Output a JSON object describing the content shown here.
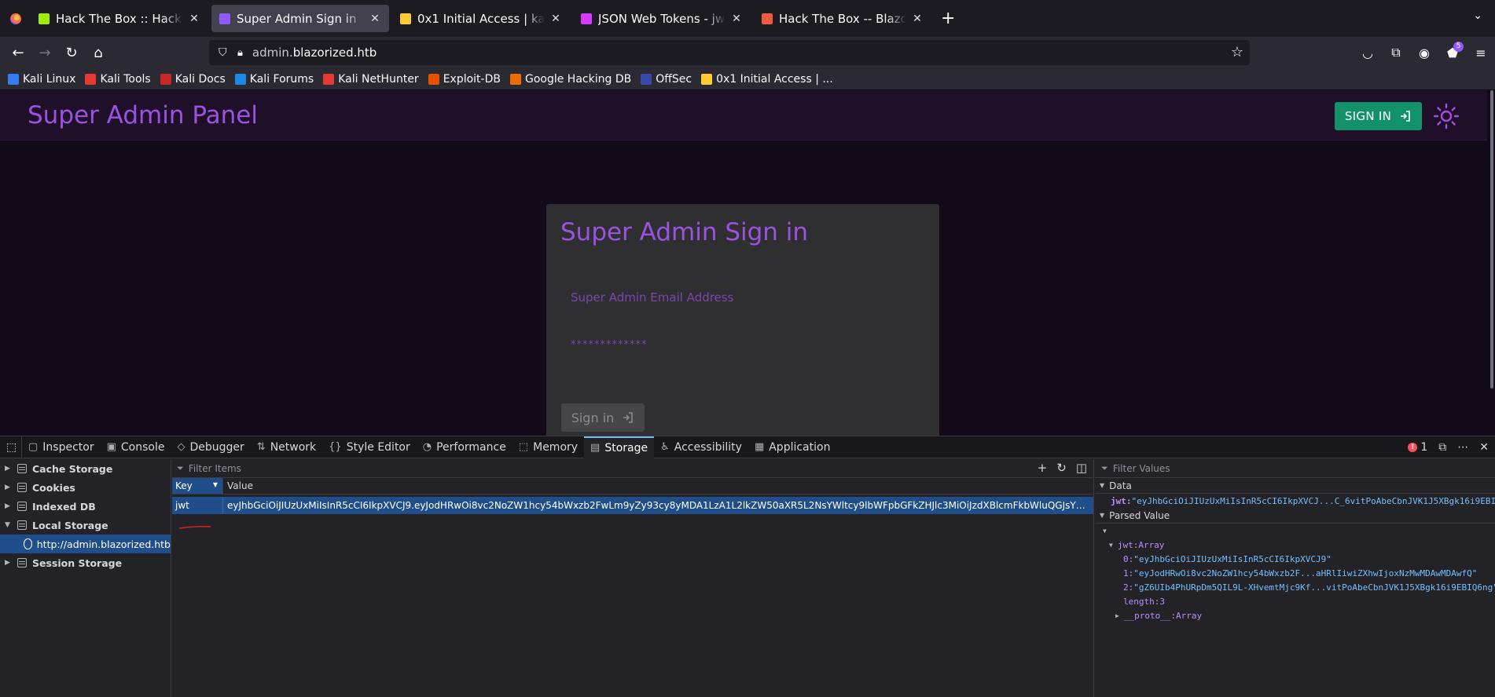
{
  "browser": {
    "tabs": [
      {
        "title": "Hack The Box :: Hack The",
        "active": false,
        "favicon_color": "#9fef00"
      },
      {
        "title": "Super Admin Sign in",
        "active": true,
        "favicon_color": "#9059ff"
      },
      {
        "title": "0x1 Initial Access | katop",
        "active": false,
        "favicon_color": "#ffcc33"
      },
      {
        "title": "JSON Web Tokens - jwt.io",
        "active": false,
        "favicon_color": "#d63aff"
      },
      {
        "title": "Hack The Box -- Blazoriz",
        "active": false,
        "favicon_color": "#ef5a3c"
      }
    ],
    "url": {
      "subdomain": "admin.",
      "domain": "blazorized.htb"
    },
    "extension_badge": "5",
    "bookmarks": [
      {
        "label": "Kali Linux",
        "color": "#367bf0"
      },
      {
        "label": "Kali Tools",
        "color": "#e53935"
      },
      {
        "label": "Kali Docs",
        "color": "#c62828"
      },
      {
        "label": "Kali Forums",
        "color": "#1e88e5"
      },
      {
        "label": "Kali NetHunter",
        "color": "#e53935"
      },
      {
        "label": "Exploit-DB",
        "color": "#e65100"
      },
      {
        "label": "Google Hacking DB",
        "color": "#ef6c00"
      },
      {
        "label": "OffSec",
        "color": "#3949ab"
      },
      {
        "label": "0x1 Initial Access | ...",
        "color": "#ffcc33"
      }
    ]
  },
  "page": {
    "app_title": "Super Admin Panel",
    "top_signin_label": "SIGN IN",
    "card": {
      "title": "Super Admin Sign in",
      "email_placeholder": "Super Admin Email Address",
      "password_placeholder": "*************",
      "signin_label": "Sign in"
    }
  },
  "devtools": {
    "tabs": [
      {
        "label": "Inspector",
        "icon": "inspector-icon",
        "glyph": "▢"
      },
      {
        "label": "Console",
        "icon": "console-icon",
        "glyph": "▣"
      },
      {
        "label": "Debugger",
        "icon": "debugger-icon",
        "glyph": "◇"
      },
      {
        "label": "Network",
        "icon": "network-icon",
        "glyph": "⇅"
      },
      {
        "label": "Style Editor",
        "icon": "style-editor-icon",
        "glyph": "{}"
      },
      {
        "label": "Performance",
        "icon": "performance-icon",
        "glyph": "◔"
      },
      {
        "label": "Memory",
        "icon": "memory-icon",
        "glyph": "⬚"
      },
      {
        "label": "Storage",
        "icon": "storage-icon",
        "glyph": "▤",
        "active": true
      },
      {
        "label": "Accessibility",
        "icon": "accessibility-icon",
        "glyph": "♿"
      },
      {
        "label": "Application",
        "icon": "application-icon",
        "glyph": "▦"
      }
    ],
    "error_count": "1",
    "tree": {
      "cache_storage": "Cache Storage",
      "cookies": "Cookies",
      "indexed_db": "Indexed DB",
      "local_storage": "Local Storage",
      "local_origin": "http://admin.blazorized.htb",
      "session_storage": "Session Storage"
    },
    "filter_items_placeholder": "Filter Items",
    "filter_values_placeholder": "Filter Values",
    "table": {
      "col_key": "Key",
      "col_value": "Value",
      "row": {
        "key": "jwt",
        "value": "eyJhbGciOiJIUzUxMiIsInR5cCI6IkpXVCJ9.eyJodHRwOi8vc2NoZW1hcy54bWxzb2FwLm9yZy93cy8yMDA1LzA1L2lkZW50aXR5L2NsYWltcy9lbWFpbGFkZHJlc3MiOiJzdXBlcmFkbWluQGJsYXpvcml6ZWQuaH..."
      }
    },
    "side": {
      "data_label": "Data",
      "data_key": "jwt",
      "data_value": "\"eyJhbGciOiJIUzUxMiIsInR5cCI6IkpXVCJ...C_6vitPoAbeCbnJVK1J5XBgk16i9EBIQ6ng\"",
      "parsed_label": "Parsed Value",
      "parsed_array_label": "jwt:Array",
      "items": [
        {
          "idx": "0:",
          "val": "\"eyJhbGciOiJIUzUxMiIsInR5cCI6IkpXVCJ9\""
        },
        {
          "idx": "1:",
          "val": "\"eyJodHRwOi8vc2NoZW1hcy54bWxzb2F...aHRlIiwiZXhwIjoxNzMwMDAwMDAwfQ\""
        },
        {
          "idx": "2:",
          "val": "\"gZ6UIb4PhURpDm5QIL9L-XHvemtMjc9Kf...vitPoAbeCbnJVK1J5XBgk16i9EBIQ6ng\""
        }
      ],
      "length_label": "length:3",
      "proto_label": "__proto__:Array"
    }
  }
}
